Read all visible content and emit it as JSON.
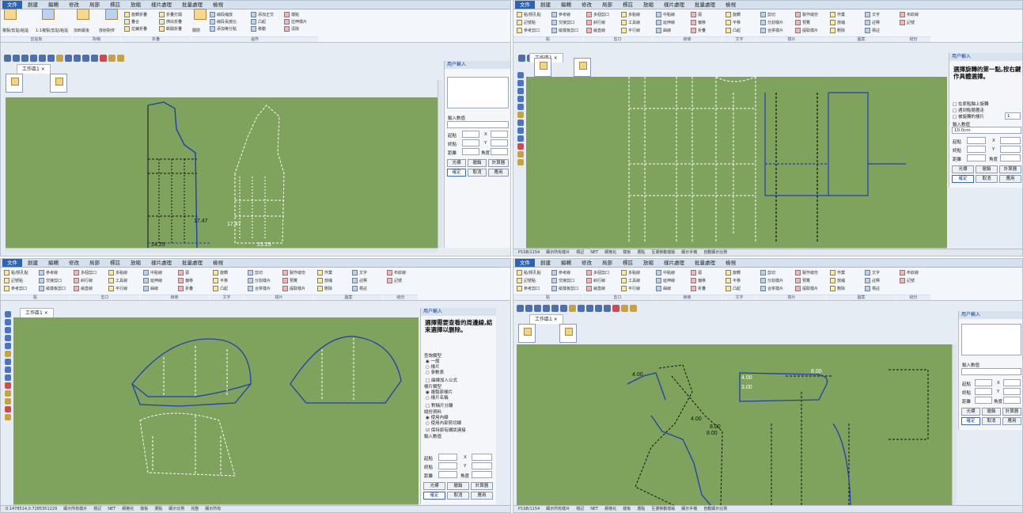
{
  "menus": {
    "q0": [
      "文件",
      "創建",
      "編輯",
      "修改",
      "局部",
      "標註",
      "放縮",
      "樣片處理",
      "批量處理",
      "檢視"
    ],
    "q1": [
      "文件",
      "創建",
      "編輯",
      "修改",
      "局部",
      "標註",
      "放縮",
      "樣片處理",
      "批量處理",
      "檢視"
    ],
    "q2": [
      "文件",
      "創建",
      "編輯",
      "修改",
      "局部",
      "標註",
      "放縮",
      "樣片處理",
      "批量處理",
      "檢視"
    ],
    "q3": [
      "文件",
      "創建",
      "編輯",
      "修改",
      "局部",
      "標註",
      "放縮",
      "樣片處理",
      "批量處理",
      "檢視"
    ]
  },
  "ribbon_q0": {
    "buttons": [
      "複製/剪貼/粘貼",
      "1:1複製/剪貼/粘貼",
      "加到最後",
      "放射對齊",
      "旋轉折疊",
      "疊合",
      "拉鍊折疊",
      "折疊打開",
      "擠出折疊",
      "斷開折疊",
      "拉長疊合",
      "打開折疊",
      "關閉",
      "線段縮放",
      "線段長度比",
      "添加等分點",
      "添加正交",
      "凸起",
      "移動",
      "端點",
      "拉伸樣片",
      "移動點",
      "增加點",
      "刪除點",
      "清除"
    ],
    "groups": [
      "剪貼板",
      "對稱",
      "折疊",
      "邊界"
    ]
  },
  "ribbon_common": {
    "buttons": [
      "點/標孔點",
      "記號點",
      "參考剪口",
      "參考線",
      "交接剪口",
      "繞樣板剪口",
      "多個剪口",
      "斜行線",
      "繪直線",
      "多點線",
      "工具線",
      "平行線",
      "中點線",
      "延伸線",
      "曲線",
      "弧",
      "偏移",
      "折疊",
      "旋轉",
      "平移",
      "凸起",
      "剪切",
      "分割樣片",
      "合併樣片",
      "製作縫份",
      "預覽",
      "提取樣片",
      "作業",
      "放縮",
      "刪除",
      "文字",
      "註釋",
      "標註",
      "布紋線",
      "記號"
    ],
    "groups": [
      "點",
      "剪口",
      "線條",
      "文字",
      "樣片",
      "圖案",
      "縫份"
    ]
  },
  "doc_tabs": {
    "q0": "工作區1",
    "q1": "工作區1",
    "q2": "工作區1",
    "q3": "工作區1"
  },
  "panel_q0": {
    "title": "用户輸入",
    "input_label": "輸入數值",
    "start_label": "起點",
    "end_label": "終點",
    "dist_label": "距離",
    "x_label": "X",
    "y_label": "Y",
    "angle_label": "角度",
    "btns": [
      "光標",
      "撤銷",
      "計算器",
      "確定",
      "取消",
      "應用"
    ]
  },
  "panel_q1": {
    "title": "用户輸入",
    "message": "選擇旋轉的第一點,按右鍵作具體選擇。",
    "checks": [
      "在原點軸上旋轉",
      "遇到點隨著走",
      "被旋轉的樣片"
    ],
    "check_value": "1",
    "input_label": "輸入數值",
    "input_value": "10.0cm",
    "start_label": "起點",
    "end_label": "終點",
    "dist_label": "距離",
    "x_label": "X",
    "y_label": "Y",
    "angle_label": "角度",
    "btns": [
      "光標",
      "撤銷",
      "計算器",
      "確定",
      "取消",
      "應用"
    ]
  },
  "panel_q2": {
    "title": "用户輸入",
    "message": "選擇需要查看的周邊線,結束選擇以删除。",
    "section1": "查詢類型",
    "opts1": [
      "一般",
      "樣片",
      "參數表"
    ],
    "check1": "曲線加入公式",
    "section2": "樣片類型",
    "opts2": [
      "複製原樣片",
      "樣片名稱"
    ],
    "check2": "對稱片分離",
    "section3": "縫份資料",
    "opts3": [
      "使用內線",
      "使用內部剪切線"
    ],
    "check3": "保持原有網狀連接",
    "input_label": "輸入數值",
    "start_label": "起點",
    "end_label": "終點",
    "dist_label": "距離",
    "x_label": "X",
    "y_label": "Y",
    "angle_label": "角度",
    "btns": [
      "光標",
      "撤銷",
      "計算器",
      "確定",
      "取消",
      "應用"
    ]
  },
  "panel_q3": {
    "title": "用户輸入",
    "input_label": "輸入數值",
    "start_label": "起點",
    "end_label": "終點",
    "dist_label": "距離",
    "x_label": "X",
    "y_label": "Y",
    "angle_label": "角度",
    "btns": [
      "光標",
      "撤銷",
      "計算器",
      "確定",
      "取消",
      "應用"
    ]
  },
  "measures_q0": [
    "17.47",
    "17.47",
    "24.25",
    "23.25"
  ],
  "measures_q3": [
    "4.00",
    "4.00",
    "3.00",
    "8.00",
    "4.00",
    "8.00",
    "8.00"
  ],
  "status": {
    "q1": [
      "P1SB/1154",
      "顯示所有樣片",
      "標記",
      "NET",
      "網格化",
      "樣板",
      "選點",
      "互選移動樣版",
      "顯示手機",
      "自動顯示比例",
      "顯示比例"
    ],
    "q2": [
      "0.1478514,0.7285351229",
      "顯示所有樣片",
      "標記",
      "NET",
      "網格化",
      "樣板",
      "選點",
      "顯示比例",
      "完整",
      "顯示所有",
      "工程",
      "顯示比例",
      "捕捉模式",
      "顯示比例"
    ],
    "q3": [
      "P1SB/1154",
      "顯示所有樣片",
      "標記",
      "NET",
      "網格化",
      "樣板",
      "選點",
      "互選移動樣版",
      "顯示手機",
      "自動顯示比例",
      "顯示比例"
    ]
  },
  "colors": {
    "canvas": "#7fa35d",
    "blue_line": "#1f3fb0",
    "white_line": "#ffffff",
    "black_line": "#111111",
    "accent": "#2a64b8"
  }
}
